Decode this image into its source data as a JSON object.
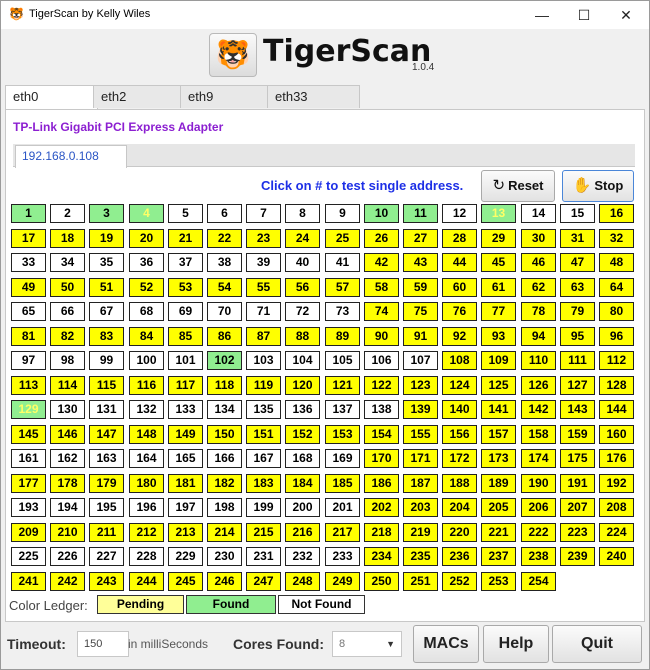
{
  "window": {
    "title": "TigerScan by Kelly Wiles",
    "minimize_glyph": "—",
    "maximize_glyph": "☐",
    "close_glyph": "✕",
    "app_icon": "tiger-icon"
  },
  "brand": {
    "logo_icon": "tiger-logo-icon",
    "logo_glyph": "🐯",
    "name": "TigerScan",
    "version": "1.0.4"
  },
  "interface_tabs": [
    "eth0",
    "eth2",
    "eth9",
    "eth33"
  ],
  "active_interface_tab": "eth0",
  "adapter_name": "TP-Link Gigabit PCI Express Adapter",
  "subnet_tab": "192.168.0.108",
  "instruction": "Click on # to test single address.",
  "buttons": {
    "reset": "Reset",
    "reset_icon": "refresh-icon",
    "stop": "Stop",
    "stop_icon": "hand-icon"
  },
  "colors": {
    "found": "#90ee90",
    "pending": "#ffff00",
    "not_found": "#ffffff",
    "adapter_text": "#8c1fd1",
    "instruction_text": "#1d2fe6",
    "subnet_text": "#2a55c5"
  },
  "address_grid": {
    "columns": 16,
    "found": [
      1,
      3,
      4,
      10,
      11,
      13,
      102,
      129
    ],
    "highlighted": [
      4,
      13,
      129
    ],
    "not_found": [
      2,
      5,
      6,
      7,
      8,
      9,
      12,
      14,
      15,
      33,
      34,
      35,
      36,
      37,
      38,
      39,
      40,
      41,
      65,
      66,
      67,
      68,
      69,
      70,
      71,
      72,
      73,
      97,
      98,
      99,
      100,
      101,
      103,
      104,
      105,
      106,
      107,
      130,
      131,
      132,
      133,
      134,
      135,
      136,
      137,
      138,
      161,
      162,
      163,
      164,
      165,
      166,
      167,
      168,
      169,
      193,
      194,
      195,
      196,
      197,
      198,
      199,
      200,
      201,
      225,
      226,
      227,
      228,
      229,
      230,
      231,
      232,
      233
    ],
    "count": 254
  },
  "ledger": {
    "label": "Color Ledger:",
    "pending": "Pending",
    "found": "Found",
    "not_found": "Not Found"
  },
  "footer": {
    "timeout_label": "Timeout:",
    "timeout_value": "150",
    "timeout_unit": "in milliSeconds",
    "cores_label": "Cores Found:",
    "cores_value": "8",
    "macs": "MACs",
    "help": "Help",
    "quit": "Quit"
  }
}
